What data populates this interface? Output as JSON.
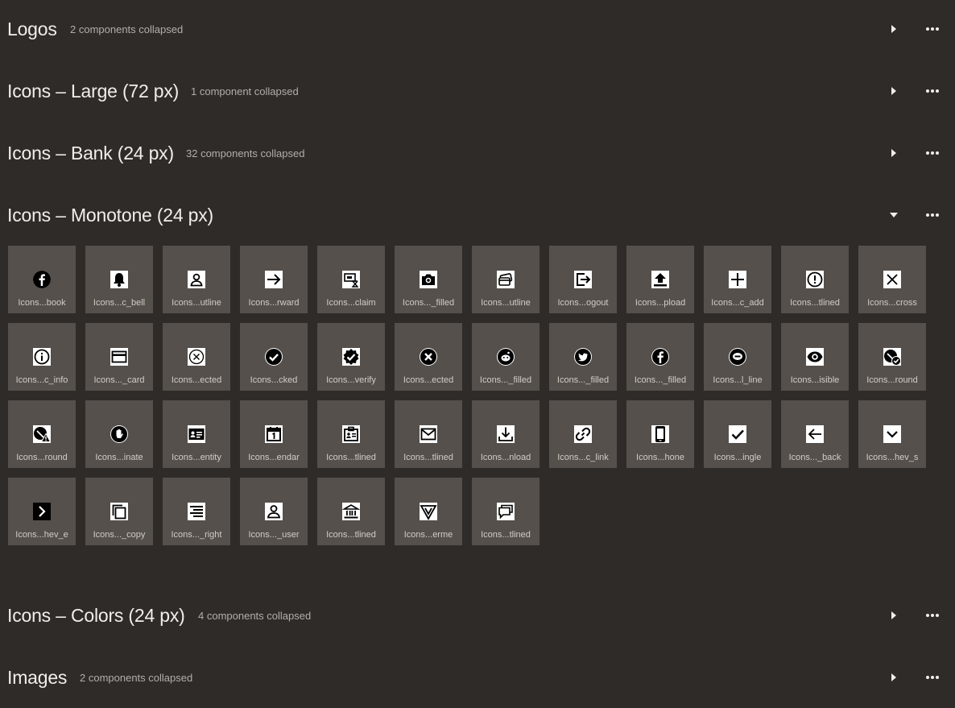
{
  "sections": [
    {
      "title": "Logos",
      "meta": "2 components collapsed",
      "state": "collapsed"
    },
    {
      "title": "Icons – Large (72 px)",
      "meta": "1 component collapsed",
      "state": "collapsed"
    },
    {
      "title": "Icons – Bank (24 px)",
      "meta": "32 components collapsed",
      "state": "collapsed"
    },
    {
      "title": "Icons – Monotone (24 px)",
      "meta": "",
      "state": "expanded"
    },
    {
      "title": "Icons – Colors (24 px)",
      "meta": "4 components collapsed",
      "state": "collapsed"
    },
    {
      "title": "Images",
      "meta": "2 components collapsed",
      "state": "collapsed"
    }
  ],
  "icon_tiles": [
    {
      "label": "Icons...book",
      "icon": "facebook-icon"
    },
    {
      "label": "Icons...c_bell",
      "icon": "bell-icon"
    },
    {
      "label": "Icons...utline",
      "icon": "user-outline-icon"
    },
    {
      "label": "Icons...rward",
      "icon": "arrow-forward-icon"
    },
    {
      "label": "Icons...claim",
      "icon": "claim-icon"
    },
    {
      "label": "Icons..._filled",
      "icon": "camera-icon"
    },
    {
      "label": "Icons...utline",
      "icon": "cards-outline-icon"
    },
    {
      "label": "Icons...ogout",
      "icon": "logout-icon"
    },
    {
      "label": "Icons...pload",
      "icon": "upload-icon"
    },
    {
      "label": "Icons...c_add",
      "icon": "plus-icon"
    },
    {
      "label": "Icons...tlined",
      "icon": "alert-outlined-icon"
    },
    {
      "label": "Icons...cross",
      "icon": "cross-icon"
    },
    {
      "label": "Icons...c_info",
      "icon": "info-icon"
    },
    {
      "label": "Icons..._card",
      "icon": "card-icon"
    },
    {
      "label": "Icons...ected",
      "icon": "rejected-outline-icon"
    },
    {
      "label": "Icons...cked",
      "icon": "checked-icon"
    },
    {
      "label": "Icons...verify",
      "icon": "verify-badge-icon"
    },
    {
      "label": "Icons...ected",
      "icon": "rejected-filled-icon"
    },
    {
      "label": "Icons..._filled",
      "icon": "reddit-icon"
    },
    {
      "label": "Icons..._filled",
      "icon": "twitter-icon"
    },
    {
      "label": "Icons..._filled",
      "icon": "facebook-filled-icon"
    },
    {
      "label": "Icons...l_line",
      "icon": "line-icon"
    },
    {
      "label": "Icons...isible",
      "icon": "eye-icon"
    },
    {
      "label": "Icons...round",
      "icon": "user-check-icon"
    },
    {
      "label": "Icons...round",
      "icon": "user-warning-icon"
    },
    {
      "label": "Icons...inate",
      "icon": "hand-stop-icon"
    },
    {
      "label": "Icons...entity",
      "icon": "identity-card-icon"
    },
    {
      "label": "Icons...endar",
      "icon": "calendar-icon"
    },
    {
      "label": "Icons...tlined",
      "icon": "badge-outlined-icon"
    },
    {
      "label": "Icons...tlined",
      "icon": "mail-outlined-icon"
    },
    {
      "label": "Icons...nload",
      "icon": "download-icon"
    },
    {
      "label": "Icons...c_link",
      "icon": "link-icon"
    },
    {
      "label": "Icons...hone",
      "icon": "phone-icon"
    },
    {
      "label": "Icons...ingle",
      "icon": "check-single-icon"
    },
    {
      "label": "Icons..._back",
      "icon": "arrow-back-icon"
    },
    {
      "label": "Icons...hev_s",
      "icon": "chevron-down-icon"
    },
    {
      "label": "Icons...hev_e",
      "icon": "chevron-right-icon"
    },
    {
      "label": "Icons..._copy",
      "icon": "copy-icon"
    },
    {
      "label": "Icons..._right",
      "icon": "align-right-icon"
    },
    {
      "label": "Icons..._user",
      "icon": "user-icon"
    },
    {
      "label": "Icons...tlined",
      "icon": "bank-outlined-icon"
    },
    {
      "label": "Icons...erme",
      "icon": "verme-logo-icon"
    },
    {
      "label": "Icons...tlined",
      "icon": "chat-outlined-icon"
    }
  ],
  "colors": {
    "background": "#2f2b29",
    "tile": "#55504c",
    "icon_bg": "#ffffff",
    "icon_fg": "#000000"
  }
}
